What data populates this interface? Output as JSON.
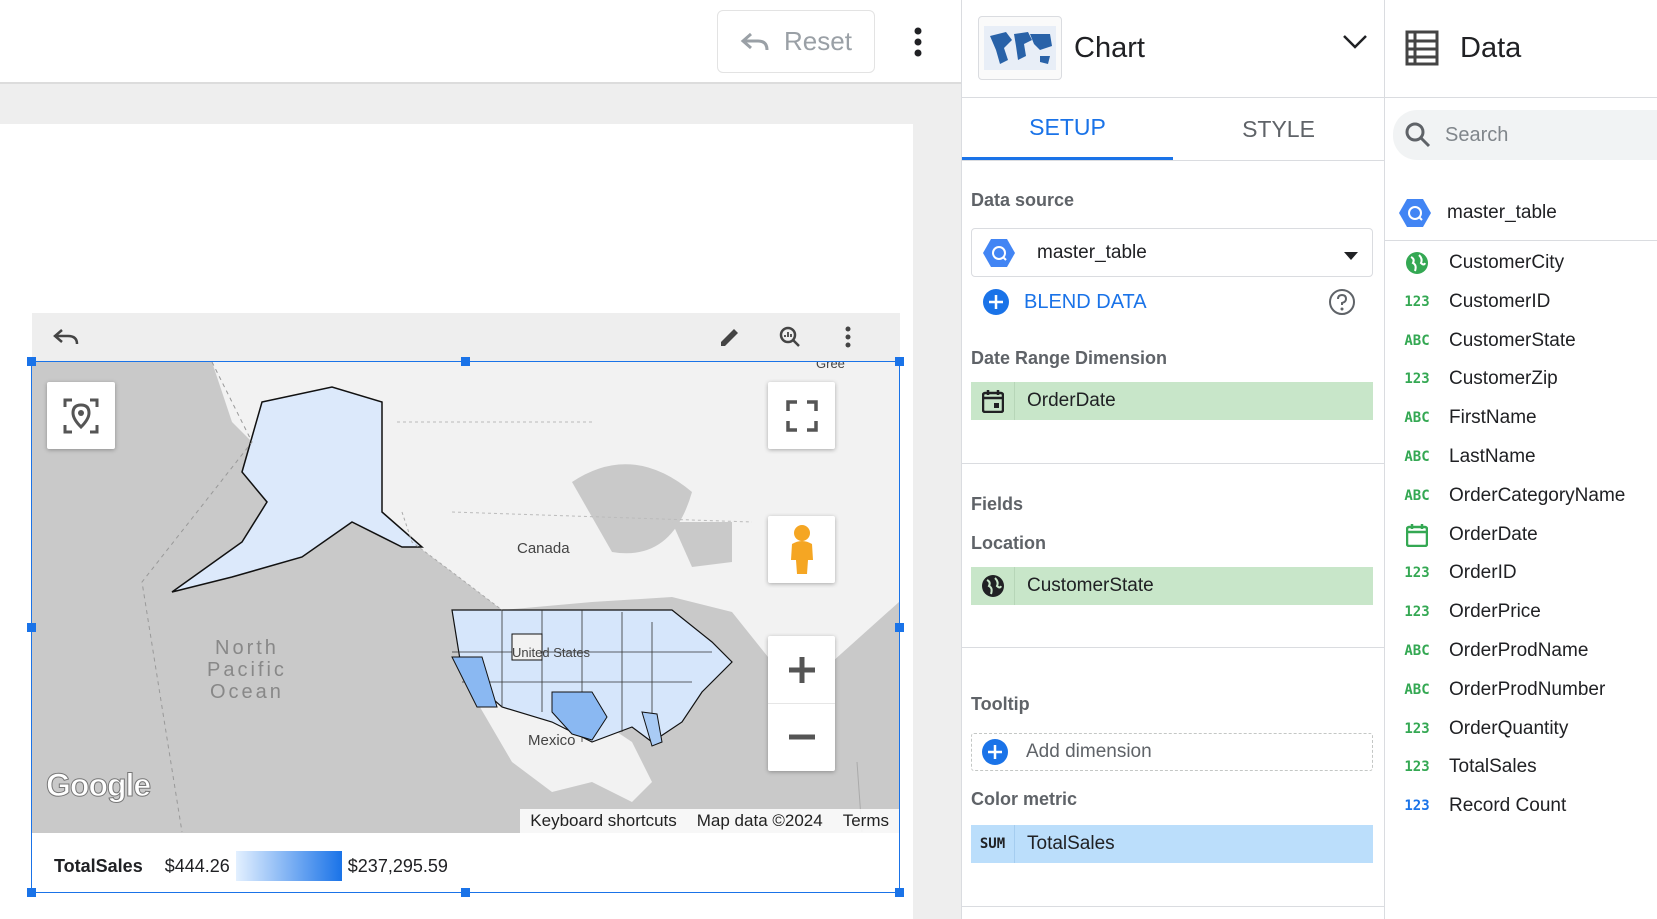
{
  "toolbar": {
    "reset_label": "Reset"
  },
  "map": {
    "labels": {
      "canada": "Canada",
      "united_states": "United States",
      "mexico": "Mexico",
      "ocean_line1": "North",
      "ocean_line2": "Pacific",
      "ocean_line3": "Ocean",
      "greenland": "Gree"
    },
    "logo": "Google",
    "attribution": {
      "shortcuts": "Keyboard shortcuts",
      "map_data": "Map data ©2024",
      "terms": "Terms"
    }
  },
  "legend": {
    "title": "TotalSales",
    "min": "$444.26",
    "max": "$237,295.59",
    "color_low": "#e3f0ff",
    "color_high": "#1a73e8"
  },
  "chart_panel": {
    "title": "Chart",
    "tabs": [
      {
        "label": "SETUP"
      },
      {
        "label": "STYLE"
      }
    ],
    "data_source_label": "Data source",
    "data_source_value": "master_table",
    "blend_label": "BLEND DATA",
    "date_range_label": "Date Range Dimension",
    "date_range_value": "OrderDate",
    "fields_label": "Fields",
    "location_label": "Location",
    "location_value": "CustomerState",
    "tooltip_label": "Tooltip",
    "add_dimension": "Add dimension",
    "color_metric_label": "Color metric",
    "color_metric_agg": "SUM",
    "color_metric_value": "TotalSales"
  },
  "data_panel": {
    "title": "Data",
    "search_placeholder": "Search",
    "source": "master_table",
    "fields": [
      {
        "type": "geo",
        "name": "CustomerCity"
      },
      {
        "type": "123",
        "name": "CustomerID"
      },
      {
        "type": "ABC",
        "name": "CustomerState"
      },
      {
        "type": "123",
        "name": "CustomerZip"
      },
      {
        "type": "ABC",
        "name": "FirstName"
      },
      {
        "type": "ABC",
        "name": "LastName"
      },
      {
        "type": "ABC",
        "name": "OrderCategoryName"
      },
      {
        "type": "date",
        "name": "OrderDate"
      },
      {
        "type": "123",
        "name": "OrderID"
      },
      {
        "type": "123",
        "name": "OrderPrice"
      },
      {
        "type": "ABC",
        "name": "OrderProdName"
      },
      {
        "type": "ABC",
        "name": "OrderProdNumber"
      },
      {
        "type": "123",
        "name": "OrderQuantity"
      },
      {
        "type": "123",
        "name": "TotalSales"
      },
      {
        "type": "123-metric",
        "name": "Record Count"
      }
    ]
  },
  "colors": {
    "accent": "#1a73e8",
    "dimension_chip": "#c8e6c9",
    "metric_chip": "#bbdefb",
    "field_type": "#34a853"
  }
}
